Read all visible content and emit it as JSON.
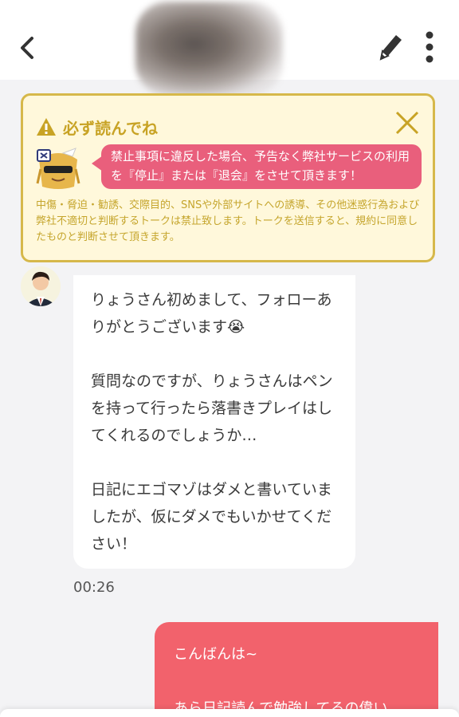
{
  "header": {
    "back_icon": "chevron-left-icon",
    "edit_icon": "pencil-icon",
    "more_icon": "vertical-dots-icon"
  },
  "notice": {
    "title": "必ず読んでね",
    "warning_icon": "warning-triangle-icon",
    "close_icon": "close-icon",
    "mascot_icon": "mascot-icon",
    "highlight": "禁止事項に違反した場合、予告なく弊社サービスの利用を『停止』または『退会』をさせて頂きます！",
    "body": "中傷・脅迫・勧誘、交際目的、SNSや外部サイトへの誘導、その他迷惑行為および弊社不適切と判断するトークは禁止致します。トークを送信すると、規約に同意したものと判断させて頂きます。",
    "colors": {
      "border": "#d6b84a",
      "background": "#fff8db",
      "text": "#c5a52c",
      "highlight_bg": "#e95f7c"
    }
  },
  "messages": [
    {
      "direction": "incoming",
      "avatar_icon": "user-avatar-icon",
      "text": "りょうさん初めまして、フォローありがとうございます😭\n\n質問なのですが、りょうさんはペンを持って行ったら落書きプレイはしてくれるのでしょうか…\n\n日記にエゴマゾはダメと書いていましたが、仮にダメでもいかせてください！",
      "time": "00:26"
    },
    {
      "direction": "outgoing",
      "text": "こんばんは~\n\nあら日記読んで勉強してるの偉い",
      "color": "#f2626c"
    }
  ]
}
